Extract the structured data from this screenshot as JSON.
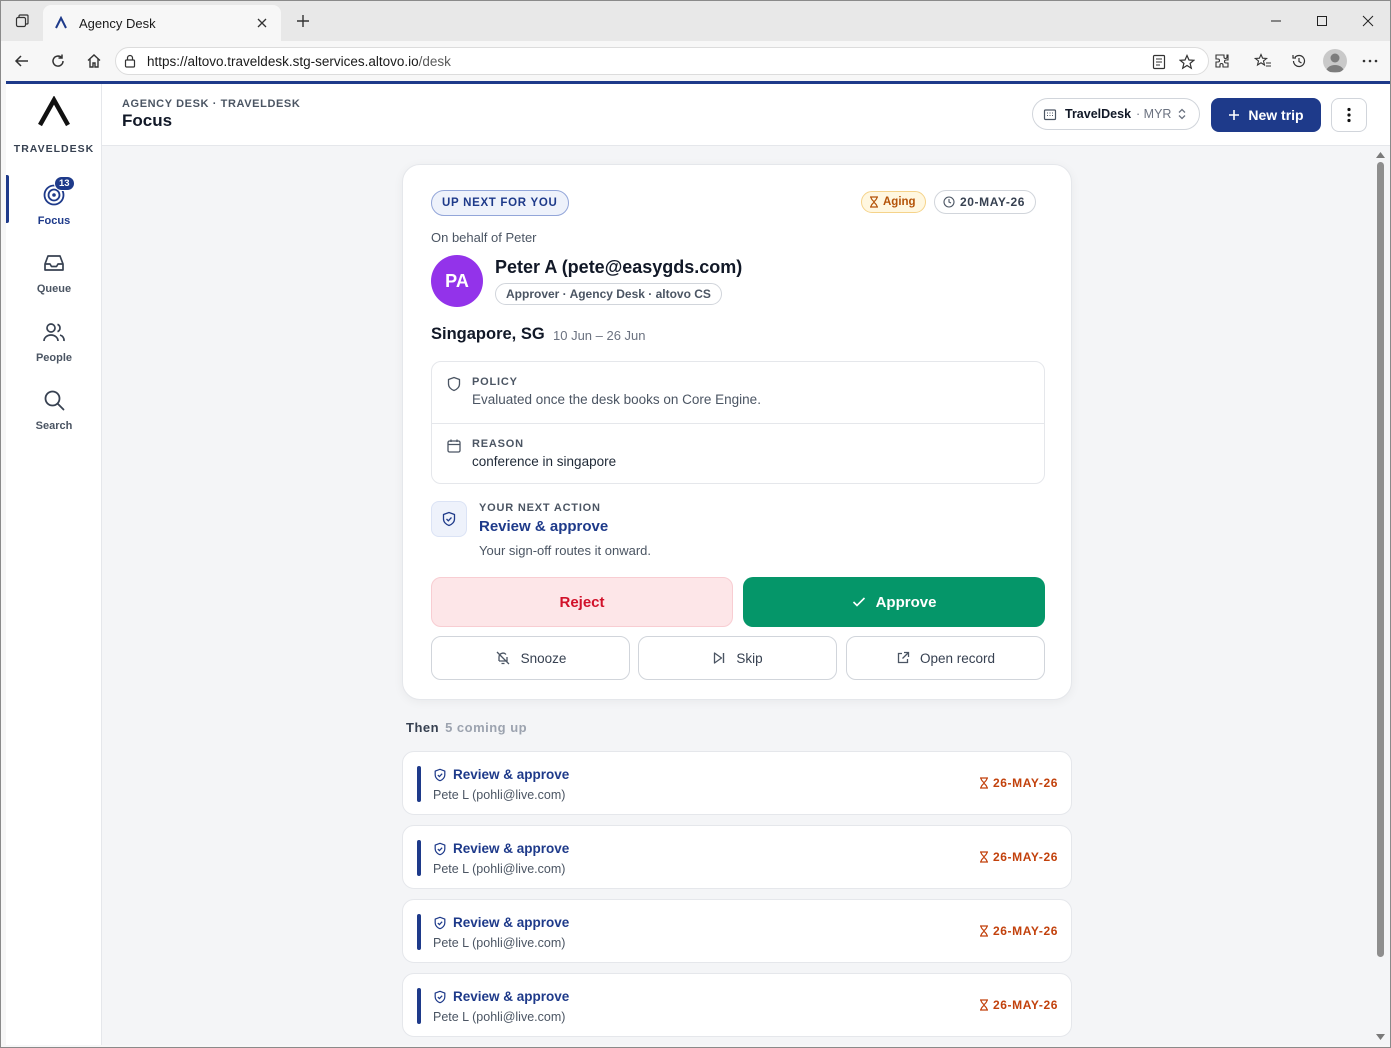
{
  "browser": {
    "tab_title": "Agency Desk",
    "url_host": "https://altovo.traveldesk.stg-services.altovo.io",
    "url_path": "/desk"
  },
  "brand": {
    "name": "TRAVELDESK"
  },
  "sidebar": {
    "items": [
      {
        "label": "Focus",
        "icon": "target-icon",
        "badge": "13",
        "active": true
      },
      {
        "label": "Queue",
        "icon": "inbox-icon"
      },
      {
        "label": "People",
        "icon": "people-icon"
      },
      {
        "label": "Search",
        "icon": "search-icon"
      }
    ]
  },
  "header": {
    "breadcrumb": "AGENCY DESK · TRAVELDESK",
    "title": "Focus",
    "workspace": {
      "name": "TravelDesk",
      "currency": "· MYR"
    },
    "new_trip_label": "New trip"
  },
  "focus_card": {
    "eyebrow": "UP NEXT FOR YOU",
    "aging_label": "Aging",
    "date": "20-MAY-26",
    "on_behalf": "On behalf of Peter",
    "avatar_initials": "PA",
    "person_name": "Peter A (pete@easygds.com)",
    "role": "Approver · Agency Desk · altovo CS",
    "destination": "Singapore, SG",
    "dates": "10 Jun – 26 Jun",
    "policy": {
      "label": "POLICY",
      "value": "Evaluated once the desk books on Core Engine."
    },
    "reason": {
      "label": "REASON",
      "value": "conference in singapore"
    },
    "next_action": {
      "label": "YOUR NEXT ACTION",
      "value": "Review & approve",
      "sub": "Your sign-off routes it onward."
    },
    "reject_label": "Reject",
    "approve_label": "Approve",
    "snooze_label": "Snooze",
    "skip_label": "Skip",
    "open_record_label": "Open record"
  },
  "upcoming": {
    "label": "Then",
    "count": "5 coming up",
    "items": [
      {
        "action": "Review & approve",
        "who": "Pete L (pohli@live.com)",
        "due": "26-MAY-26"
      },
      {
        "action": "Review & approve",
        "who": "Pete L (pohli@live.com)",
        "due": "26-MAY-26"
      },
      {
        "action": "Review & approve",
        "who": "Pete L (pohli@live.com)",
        "due": "26-MAY-26"
      },
      {
        "action": "Review & approve",
        "who": "Pete L (pohli@live.com)",
        "due": "26-MAY-26"
      }
    ]
  },
  "colors": {
    "primary": "#1e3a8a",
    "approve": "#059669",
    "reject_text": "#d1112a",
    "avatar": "#9333ea",
    "aging": "#b45309"
  }
}
